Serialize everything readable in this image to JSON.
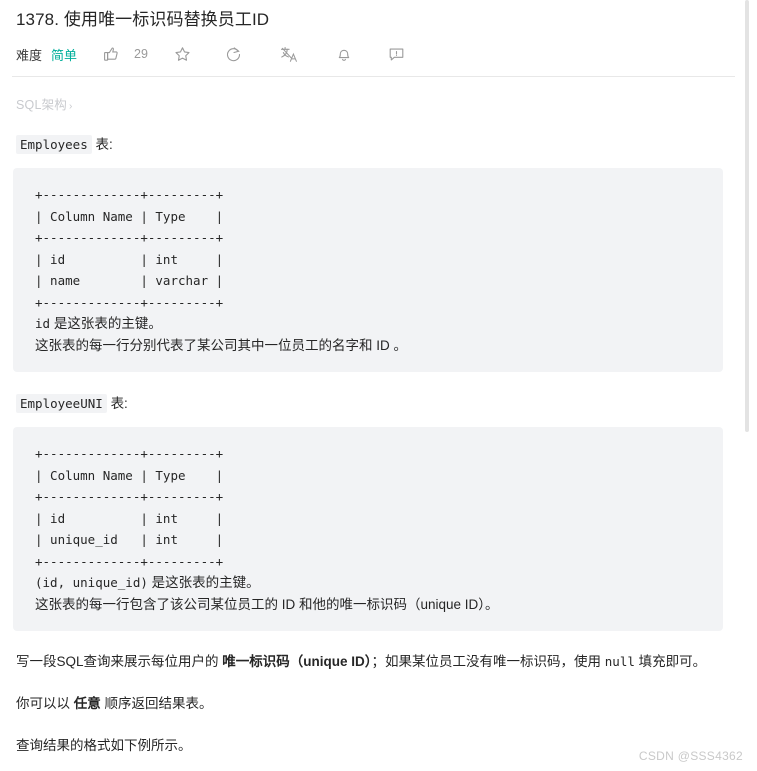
{
  "header": {
    "title": "1378. 使用唯一标识码替换员工ID",
    "difficulty_label": "难度",
    "difficulty_value": "简单",
    "difficulty_color": "#00af9b",
    "like_count": "29",
    "icons": [
      "thumbs-up-icon",
      "star-icon",
      "share-refresh-icon",
      "translate-icon",
      "bell-icon",
      "comment-icon"
    ]
  },
  "breadcrumb": {
    "label": "SQL架构",
    "chevron": "›"
  },
  "tables": [
    {
      "name": "Employees",
      "suffix": "表:",
      "ascii": "+-------------+---------+\n| Column Name | Type    |\n+-------------+---------+\n| id          | int     |\n| name        | varchar |\n+-------------+---------+",
      "notes_code": "id",
      "notes_line1_rest": " 是这张表的主键。",
      "notes_line2": "这张表的每一行分别代表了某公司其中一位员工的名字和 ID 。"
    },
    {
      "name": "EmployeeUNI",
      "suffix": "表:",
      "ascii": "+-------------+---------+\n| Column Name | Type    |\n+-------------+---------+\n| id          | int     |\n| unique_id   | int     |\n+-------------+---------+",
      "notes_code": "(id, unique_id)",
      "notes_line1_rest": " 是这张表的主键。",
      "notes_line2": "这张表的每一行包含了该公司某位员工的 ID 和他的唯一标识码（unique ID）。"
    }
  ],
  "paragraphs": {
    "p1_a": "写一段SQL查询来展示每位用户的 ",
    "p1_bold": "唯一标识码（unique ID）",
    "p1_b": "；如果某位员工没有唯一标识码，使用 ",
    "p1_code": "null",
    "p1_c": " 填充即可。",
    "p2_a": "你可以以 ",
    "p2_bold": "任意",
    "p2_b": " 顺序返回结果表。",
    "p3": "查询结果的格式如下例所示。"
  },
  "watermark": "CSDN @SSS4362"
}
